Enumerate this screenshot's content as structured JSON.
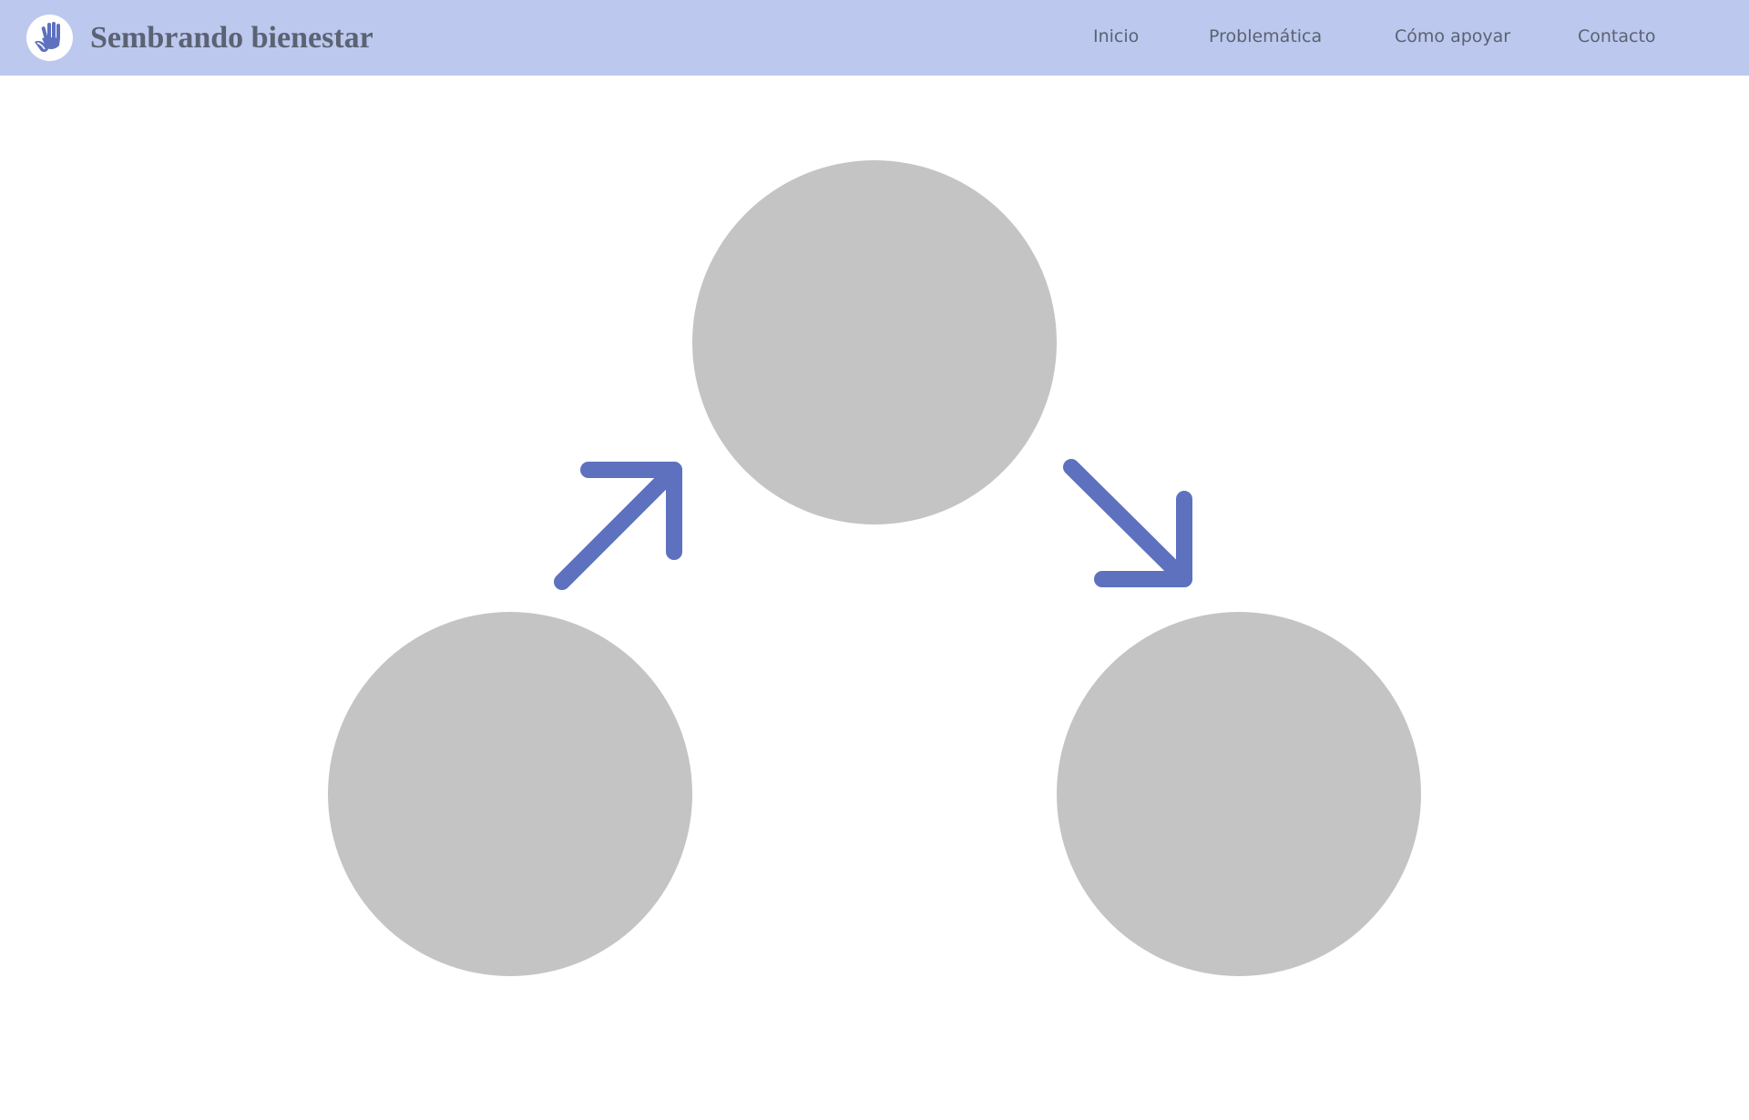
{
  "brand": {
    "title": "Sembrando bienestar",
    "logo_icon": "helping-hands-icon"
  },
  "nav": {
    "items": [
      {
        "label": "Inicio"
      },
      {
        "label": "Problemática"
      },
      {
        "label": "Cómo apoyar"
      },
      {
        "label": "Contacto"
      }
    ]
  },
  "diagram": {
    "nodes": [
      "placeholder-circle",
      "placeholder-circle",
      "placeholder-circle"
    ],
    "arrows": [
      "arrow-up-right-icon",
      "arrow-down-right-icon"
    ]
  },
  "colors": {
    "header_background": "#bcc8ee",
    "text": "#5b6273",
    "accent": "#5e71bf",
    "circle": "#c4c4c4"
  }
}
